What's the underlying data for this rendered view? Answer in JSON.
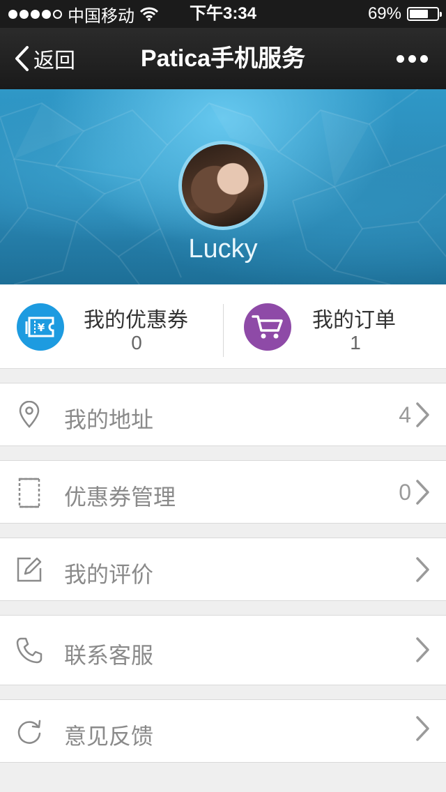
{
  "status_bar": {
    "carrier": "中国移动",
    "time": "下午3:34",
    "battery_text": "69%",
    "battery_level": 0.69,
    "signal_bars": 4
  },
  "nav": {
    "back_label": "返回",
    "title": "Patica手机服务"
  },
  "profile": {
    "username": "Lucky"
  },
  "quick_links": {
    "coupons": {
      "label": "我的优惠券",
      "count": "0",
      "color": "#1d9be0",
      "icon": "ticket-icon"
    },
    "orders": {
      "label": "我的订单",
      "count": "1",
      "color": "#8e4aa7",
      "icon": "cart-icon"
    }
  },
  "menu": [
    {
      "label": "我的地址",
      "count": "4",
      "icon": "location-pin-icon"
    },
    {
      "label": "优惠券管理",
      "count": "0",
      "icon": "coupon-icon"
    },
    {
      "label": "我的评价",
      "count": "",
      "icon": "edit-icon"
    },
    {
      "label": "联系客服",
      "count": "",
      "icon": "phone-icon"
    },
    {
      "label": "意见反馈",
      "count": "",
      "icon": "refresh-icon"
    }
  ]
}
